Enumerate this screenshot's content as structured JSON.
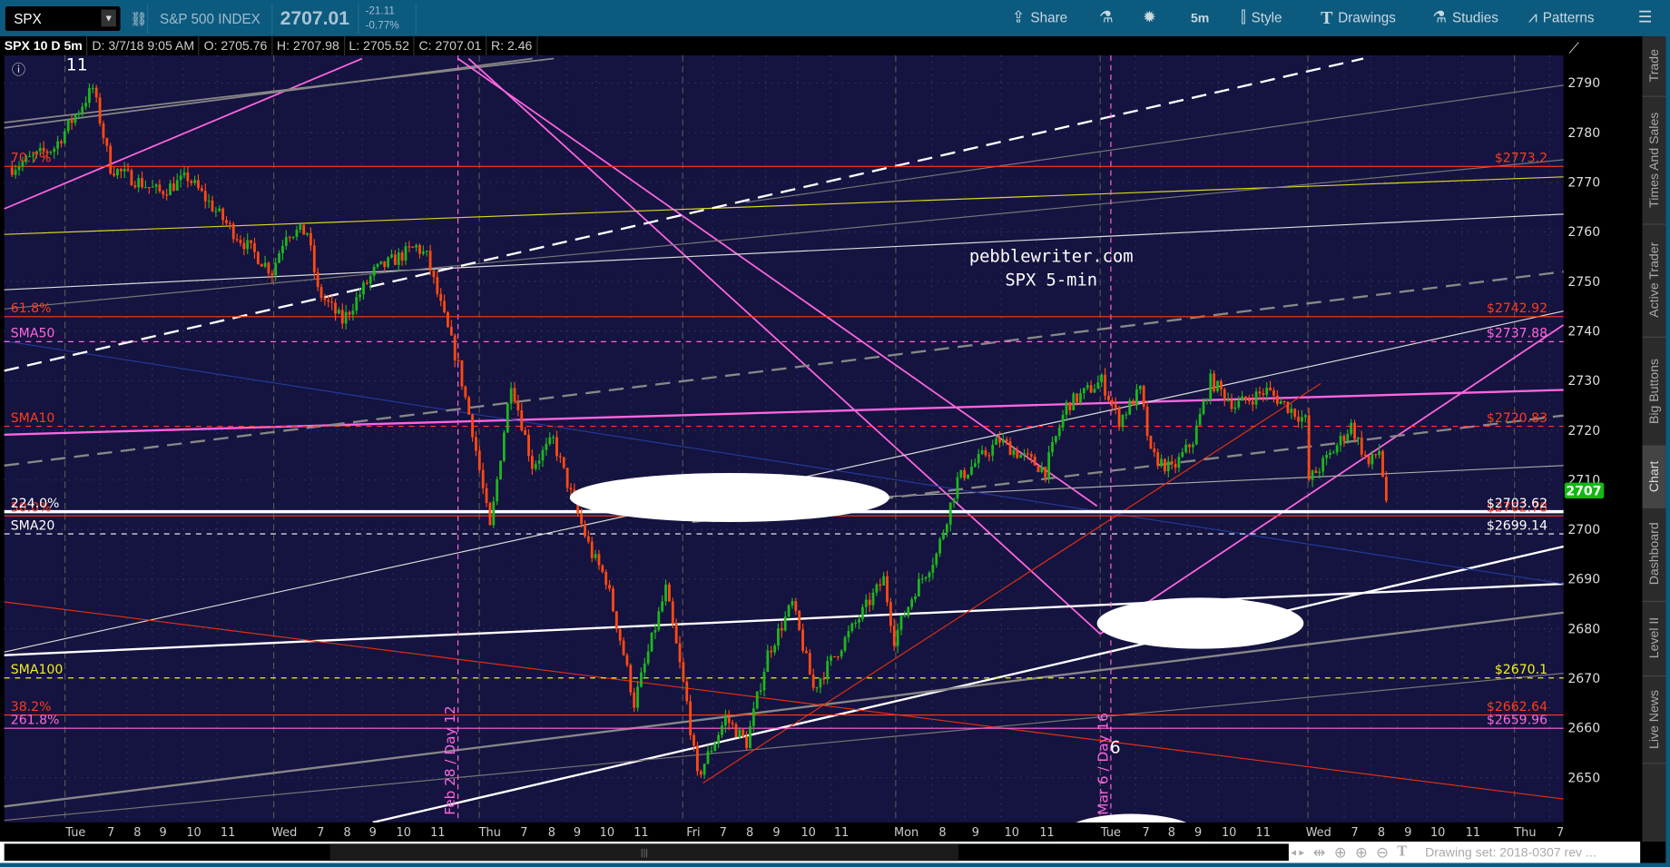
{
  "toolbar": {
    "symbol": "SPX",
    "symbol_name": "S&P 500 INDEX",
    "last_price": "2707.01",
    "change": "-21.11",
    "change_pct": "-0.77%",
    "share_label": "Share",
    "interval_label": "5m",
    "style_label": "Style",
    "drawings_label": "Drawings",
    "studies_label": "Studies",
    "patterns_label": "Patterns"
  },
  "infobar": {
    "title": "SPX 10 D 5m",
    "date": "D: 3/7/18 9:05 AM",
    "open": "O: 2705.76",
    "high": "H: 2707.98",
    "low": "L: 2705.52",
    "close": "C: 2707.01",
    "range": "R: 2.46"
  },
  "sidebar": {
    "tabs": [
      "Trade",
      "Times And Sales",
      "Active Trader",
      "Big Buttons",
      "Chart",
      "Dashboard",
      "Level II",
      "Live News"
    ],
    "active": "Chart"
  },
  "bottom": {
    "drawing_set": "Drawing set: 2018-0307 rev ...",
    "scroll_grip": "|||"
  },
  "chart_data": {
    "type": "candlestick",
    "title": "SPX 10 D 5m",
    "watermark": [
      "pebblewriter.com",
      "SPX 5-min"
    ],
    "current_price_badge": "2707",
    "ylim": [
      2643,
      2796
    ],
    "y_ticks": [
      "2790",
      "2780",
      "2770",
      "2760",
      "2750",
      "2740",
      "2730",
      "2720",
      "2710",
      "2700",
      "2690",
      "2680",
      "2670",
      "2660",
      "2650"
    ],
    "x_ticks": [
      "Tue",
      "7",
      "8",
      "9",
      "10",
      "11",
      "Wed",
      "7",
      "8",
      "9",
      "10",
      "11",
      "Thu",
      "7",
      "8",
      "9",
      "10",
      "11",
      "Fri",
      "7",
      "8",
      "9",
      "10",
      "11",
      "Mon",
      "8",
      "9",
      "10",
      "11",
      "Tue",
      "7",
      "8",
      "9",
      "10",
      "11",
      "Wed",
      "7",
      "8",
      "9",
      "10",
      "11",
      "Thu",
      "7"
    ],
    "levels": [
      {
        "left": "70.7%",
        "right": "$2773.2",
        "price": 2773.2,
        "color": "#ff3b1a",
        "style": "solid"
      },
      {
        "left": "61.8%",
        "right": "$2742.92",
        "price": 2742.92,
        "color": "#ff3b1a",
        "style": "solid"
      },
      {
        "left": "SMA50",
        "right": "$2737.88",
        "price": 2737.88,
        "color": "#ff66e0",
        "style": "dashed"
      },
      {
        "left": "SMA10",
        "right": "$2720.83",
        "price": 2720.83,
        "color": "#ff3b1a",
        "style": "dashed"
      },
      {
        "left": "50.0%",
        "right": "$2702.78",
        "price": 2702.78,
        "color": "#ff3b1a",
        "style": "solid"
      },
      {
        "left": "224.0%",
        "right": "$2703.62",
        "price": 2703.62,
        "color": "#ffffff",
        "style": "thick"
      },
      {
        "left": "SMA20",
        "right": "$2699.14",
        "price": 2699.14,
        "color": "#ffffff",
        "style": "dashed"
      },
      {
        "left": "SMA100",
        "right": "$2670.1",
        "price": 2670.1,
        "color": "#f0f020",
        "style": "dashed"
      },
      {
        "left": "38.2%",
        "right": "$2662.64",
        "price": 2662.64,
        "color": "#ff3b1a",
        "style": "solid"
      },
      {
        "left": "261.8%",
        "right": "$2659.96",
        "price": 2659.96,
        "color": "#ff66e0",
        "style": "solid"
      }
    ],
    "annotations": [
      "Feb 28 / Day 12",
      "Mar 6 / Day 16",
      "11",
      "6"
    ],
    "price_path_by_bar": [
      [
        1,
        2773
      ],
      [
        13,
        2777
      ],
      [
        24,
        2789
      ],
      [
        29,
        2773
      ],
      [
        43,
        2768
      ],
      [
        51,
        2771
      ],
      [
        64,
        2760
      ],
      [
        75,
        2752
      ],
      [
        79,
        2760
      ],
      [
        85,
        2760
      ],
      [
        88,
        2748
      ],
      [
        95,
        2742
      ],
      [
        104,
        2752
      ],
      [
        116,
        2757
      ],
      [
        119,
        2755
      ],
      [
        123,
        2745
      ],
      [
        128,
        2733
      ],
      [
        132,
        2720
      ],
      [
        137,
        2700
      ],
      [
        143,
        2730
      ],
      [
        149,
        2713
      ],
      [
        155,
        2718
      ],
      [
        161,
        2705
      ],
      [
        166,
        2695
      ],
      [
        170,
        2690
      ],
      [
        175,
        2675
      ],
      [
        178,
        2665
      ],
      [
        187,
        2688
      ],
      [
        193,
        2665
      ],
      [
        196,
        2650
      ],
      [
        204,
        2662
      ],
      [
        210,
        2657
      ],
      [
        216,
        2675
      ],
      [
        223,
        2685
      ],
      [
        229,
        2668
      ],
      [
        240,
        2680
      ],
      [
        249,
        2690
      ],
      [
        252,
        2678
      ],
      [
        258,
        2688
      ],
      [
        264,
        2695
      ],
      [
        270,
        2710
      ],
      [
        282,
        2718
      ],
      [
        288,
        2715
      ],
      [
        295,
        2712
      ],
      [
        301,
        2725
      ],
      [
        311,
        2730
      ],
      [
        316,
        2722
      ],
      [
        322,
        2728
      ],
      [
        325,
        2715
      ],
      [
        331,
        2712
      ],
      [
        337,
        2718
      ],
      [
        342,
        2730
      ],
      [
        349,
        2725
      ],
      [
        358,
        2728
      ],
      [
        369,
        2722
      ],
      [
        370,
        2710
      ],
      [
        376,
        2715
      ],
      [
        382,
        2721
      ],
      [
        387,
        2713
      ],
      [
        390,
        2716
      ],
      [
        392,
        2706
      ]
    ],
    "colors": {
      "up": "#1fb51f",
      "down": "#ff4a12",
      "background": "#15133f"
    }
  }
}
